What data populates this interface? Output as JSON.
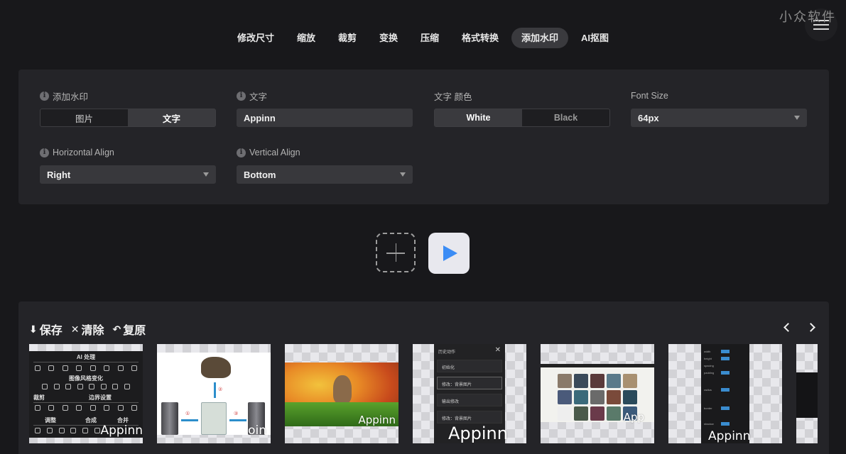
{
  "brand": {
    "watermark": "小众软件",
    "menu_icon": "hamburger-icon"
  },
  "nav": {
    "tabs": [
      {
        "label": "修改尺寸",
        "active": false
      },
      {
        "label": "缩放",
        "active": false
      },
      {
        "label": "裁剪",
        "active": false
      },
      {
        "label": "变换",
        "active": false
      },
      {
        "label": "压缩",
        "active": false
      },
      {
        "label": "格式转换",
        "active": false
      },
      {
        "label": "添加水印",
        "active": true
      },
      {
        "label": "AI抠图",
        "active": false
      }
    ]
  },
  "settings": {
    "watermark_type": {
      "label": "添加水印",
      "options": [
        "图片",
        "文字"
      ],
      "selected": "文字"
    },
    "text": {
      "label": "文字",
      "value": "Appinn"
    },
    "text_color": {
      "label": "文字 颜色",
      "options": [
        "White",
        "Black"
      ],
      "selected": "White"
    },
    "font_size": {
      "label": "Font Size",
      "value": "64px"
    },
    "horizontal_align": {
      "label": "Horizontal Align",
      "value": "Right"
    },
    "vertical_align": {
      "label": "Vertical Align",
      "value": "Bottom"
    }
  },
  "actions": {
    "add_icon": "plus-icon",
    "run_icon": "play-icon",
    "accent": "#3b8cf5"
  },
  "gallery": {
    "toolbar": [
      {
        "icon": "download-icon",
        "glyph": "⬇",
        "label": "保存"
      },
      {
        "icon": "close-icon",
        "glyph": "✕",
        "label": "清除"
      },
      {
        "icon": "undo-icon",
        "glyph": "↶",
        "label": "复原"
      }
    ],
    "pager": {
      "prev_icon": "chevron-left-icon",
      "next_icon": "chevron-right-icon"
    },
    "thumbnails": [
      {
        "kind": "ui-screenshot",
        "watermark": "Appinn",
        "headings": [
          "AI 处理",
          "图像风格变化",
          "裁剪",
          "边界设置",
          "调整",
          "合成",
          "合并"
        ]
      },
      {
        "kind": "diagram",
        "watermark": "oin",
        "markers": [
          "①",
          "②",
          "③"
        ]
      },
      {
        "kind": "photo",
        "watermark": "Appinn"
      },
      {
        "kind": "ui-panel",
        "watermark": "Appinn",
        "title": "历史动作",
        "items": [
          "初始化",
          "修改：背景图片",
          "输出修改",
          "修改：背景图片"
        ]
      },
      {
        "kind": "photo-grid",
        "watermark": "App"
      },
      {
        "kind": "settings-panel",
        "watermark": "Appinn"
      },
      {
        "kind": "partial",
        "watermark": ""
      }
    ]
  }
}
